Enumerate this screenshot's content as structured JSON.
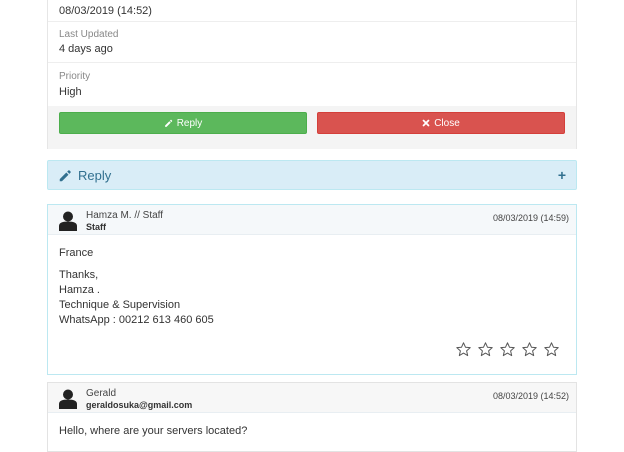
{
  "ticket_info": {
    "submitted_value": "08/03/2019 (14:52)",
    "last_updated_label": "Last Updated",
    "last_updated_value": "4 days ago",
    "priority_label": "Priority",
    "priority_value": "High",
    "reply_button": "Reply",
    "close_button": "Close"
  },
  "reply_panel": {
    "title": "Reply"
  },
  "messages": [
    {
      "author": "Hamza M. // Staff",
      "role": "Staff",
      "date": "08/03/2019 (14:59)",
      "body": [
        "France",
        "Thanks,",
        "Hamza .",
        "Technique & Supervision",
        "WhatsApp : 00212 613 460 605"
      ],
      "rating": 0,
      "rating_max": 5
    },
    {
      "author": "Gerald",
      "role": "geraldosuka@gmail.com",
      "date": "08/03/2019 (14:52)",
      "body": [
        "Hello, where are your servers located?"
      ]
    }
  ],
  "colors": {
    "reply_button": "#5cb85c",
    "close_button": "#d9534f",
    "reply_panel_bg": "#d9edf7",
    "reply_panel_text": "#31708f"
  },
  "icons": {
    "reply_button_icon": "pencil-icon",
    "close_button_icon": "times-icon",
    "panel_icon": "pencil-icon",
    "expand_icon": "plus-icon",
    "avatar_icon": "user-icon",
    "rating_icon": "star-outline-icon"
  }
}
